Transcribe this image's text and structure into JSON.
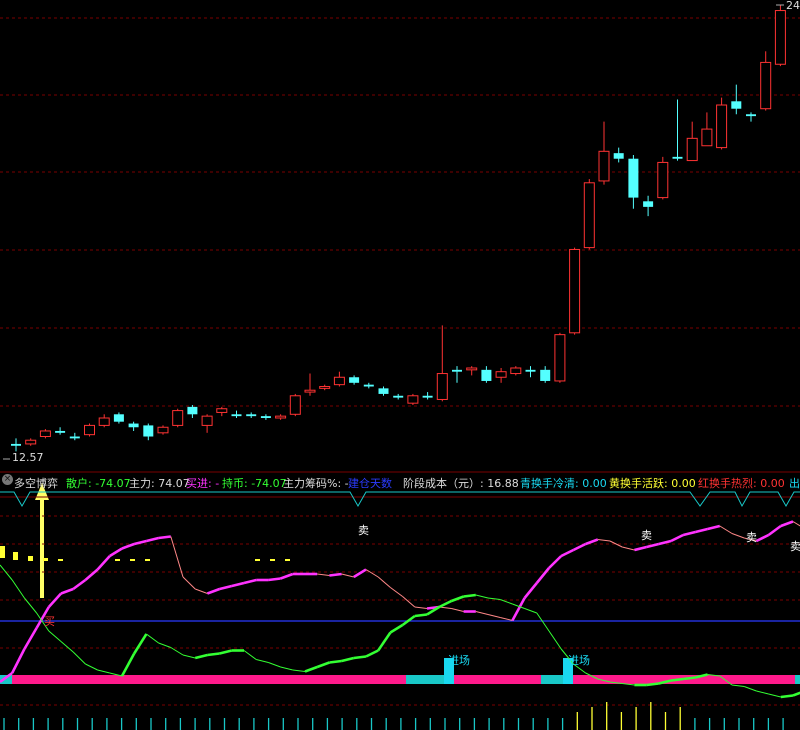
{
  "colors": {
    "background": "#000000",
    "candle_up": "#ff3333",
    "candle_down": "#54ffff",
    "grid": "#7a0000",
    "blue_line": "#2b3bff",
    "magenta": "#ff33ff",
    "salmon": "#ff8888",
    "green": "#33ff33",
    "pink_band": "#ff1a8c",
    "cyan_band": "#19c8c8",
    "yellow": "#ffff33",
    "arrow": "#ffff66"
  },
  "price_panel": {
    "high_label": "24",
    "low_label": "12.57"
  },
  "info_bar": {
    "indicator_name": "多空博弈",
    "retail": "散户: -74.07",
    "main_force": "主力: 74.07",
    "buy_in": "买进: -",
    "hold": "持币: -74.07",
    "chip_pct": "主力筹码%: -",
    "days": "建仓天数",
    "stage_cost": "阶段成本（元）: 16.88",
    "cyan_turnover": "青换手冷清: 0.00",
    "yellow_turnover": "黄换手活跃: 0.00",
    "red_turnover": "红换手热烈: 0.00",
    "out": "出"
  },
  "signals": {
    "buy": "买",
    "sell": "卖",
    "enter": "进场"
  },
  "chart_data": [
    {
      "type": "candlestick",
      "ohlc": [
        [
          12.9,
          12.85,
          13.05,
          12.7
        ],
        [
          12.9,
          13.0,
          13.05,
          12.85
        ],
        [
          13.1,
          13.25,
          13.3,
          13.05
        ],
        [
          13.25,
          13.2,
          13.35,
          13.15
        ],
        [
          13.1,
          13.05,
          13.2,
          13.0
        ],
        [
          13.15,
          13.4,
          13.45,
          13.1
        ],
        [
          13.4,
          13.6,
          13.7,
          13.35
        ],
        [
          13.7,
          13.5,
          13.75,
          13.45
        ],
        [
          13.45,
          13.35,
          13.5,
          13.25
        ],
        [
          13.4,
          13.1,
          13.45,
          13.0
        ],
        [
          13.2,
          13.35,
          13.4,
          13.15
        ],
        [
          13.4,
          13.8,
          13.85,
          13.35
        ],
        [
          13.9,
          13.7,
          13.95,
          13.6
        ],
        [
          13.4,
          13.65,
          13.7,
          13.2
        ],
        [
          13.75,
          13.85,
          13.9,
          13.65
        ],
        [
          13.7,
          13.65,
          13.8,
          13.6
        ],
        [
          13.7,
          13.65,
          13.75,
          13.6
        ],
        [
          13.65,
          13.6,
          13.7,
          13.55
        ],
        [
          13.6,
          13.65,
          13.7,
          13.55
        ],
        [
          13.7,
          14.2,
          14.25,
          13.65
        ],
        [
          14.3,
          14.35,
          14.8,
          14.2
        ],
        [
          14.4,
          14.45,
          14.5,
          14.35
        ],
        [
          14.5,
          14.7,
          14.85,
          14.45
        ],
        [
          14.7,
          14.55,
          14.75,
          14.5
        ],
        [
          14.5,
          14.45,
          14.55,
          14.4
        ],
        [
          14.4,
          14.25,
          14.45,
          14.2
        ],
        [
          14.2,
          14.15,
          14.25,
          14.1
        ],
        [
          14.0,
          14.2,
          14.25,
          13.95
        ],
        [
          14.2,
          14.15,
          14.3,
          14.1
        ],
        [
          14.1,
          14.8,
          16.1,
          14.05
        ],
        [
          14.9,
          14.85,
          15.0,
          14.55
        ],
        [
          14.9,
          14.95,
          15.0,
          14.75
        ],
        [
          14.9,
          14.6,
          15.0,
          14.55
        ],
        [
          14.7,
          14.85,
          14.95,
          14.55
        ],
        [
          14.8,
          14.95,
          15.0,
          14.75
        ],
        [
          14.9,
          14.85,
          15.0,
          14.7
        ],
        [
          14.9,
          14.6,
          15.0,
          14.55
        ],
        [
          14.6,
          15.85,
          15.9,
          14.55
        ],
        [
          15.9,
          18.15,
          18.2,
          15.85
        ],
        [
          18.2,
          19.95,
          20.05,
          18.15
        ],
        [
          20.0,
          20.8,
          21.6,
          19.9
        ],
        [
          20.75,
          20.6,
          20.9,
          20.5
        ],
        [
          20.6,
          19.55,
          20.7,
          19.25
        ],
        [
          19.45,
          19.3,
          19.6,
          19.05
        ],
        [
          19.55,
          20.5,
          20.65,
          19.5
        ],
        [
          20.65,
          20.6,
          22.2,
          20.55
        ],
        [
          20.55,
          21.15,
          21.6,
          20.6
        ],
        [
          20.95,
          21.4,
          21.85,
          20.95
        ],
        [
          20.9,
          22.05,
          22.25,
          20.85
        ],
        [
          22.15,
          21.95,
          22.6,
          21.8
        ],
        [
          21.8,
          21.75,
          21.85,
          21.6
        ],
        [
          21.95,
          23.2,
          23.5,
          21.9
        ],
        [
          23.15,
          24.6,
          24.75,
          23.1
        ]
      ]
    },
    {
      "type": "line",
      "series": [
        {
          "values": [
            12,
            18,
            34,
            48,
            62,
            71,
            74,
            80,
            87,
            96,
            101,
            104,
            106,
            108,
            109,
            82,
            74,
            71,
            74,
            76,
            78,
            80,
            80,
            81,
            84,
            84,
            84,
            83,
            84,
            82,
            87,
            82,
            75,
            69,
            62,
            61,
            62,
            61,
            59,
            59,
            57,
            55,
            53,
            68,
            78,
            88,
            96,
            100,
            104,
            107,
            106,
            102,
            100,
            102,
            104,
            106,
            110,
            112,
            114,
            116,
            111,
            108,
            106,
            110,
            116,
            119,
            114,
            108
          ]
        },
        {
          "values": [
            90,
            80,
            68,
            58,
            46,
            39,
            32,
            24,
            20,
            18,
            16,
            31,
            44,
            38,
            35,
            30,
            28,
            30,
            31,
            33,
            33,
            27,
            25,
            22,
            20,
            19,
            22,
            25,
            26,
            28,
            29,
            33,
            45,
            50,
            56,
            57,
            62,
            66,
            69,
            70,
            68,
            67,
            64,
            61,
            58,
            46,
            34,
            24,
            18,
            14,
            12,
            11,
            10,
            10,
            11,
            13,
            14,
            15,
            17,
            16,
            10,
            9,
            6,
            4,
            2,
            3,
            6
          ]
        }
      ],
      "ylim": [
        0,
        120
      ]
    }
  ]
}
